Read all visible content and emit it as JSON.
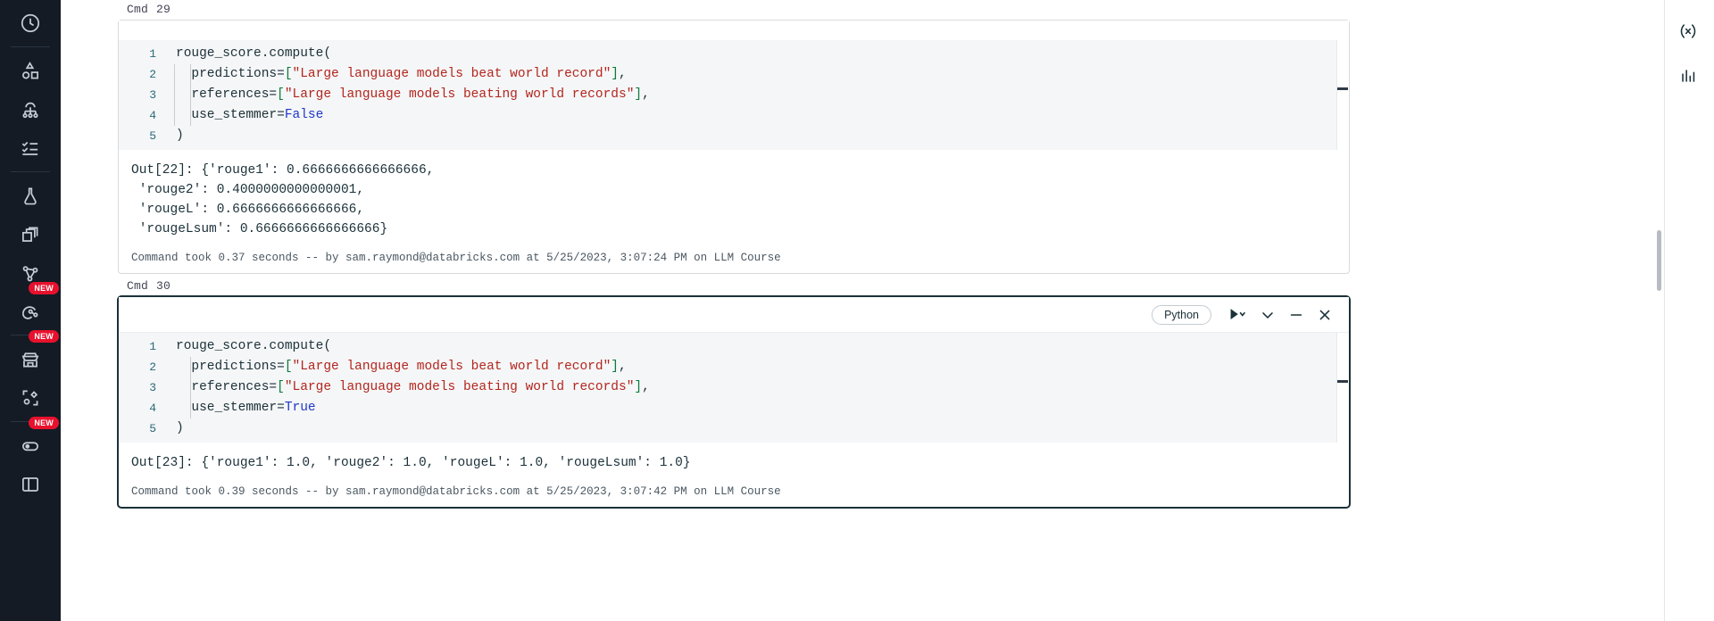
{
  "left_rail": {
    "items": [
      {
        "name": "recents",
        "icon": "clock-icon",
        "badge": null
      },
      {
        "name": "catalog",
        "icon": "shapes-icon",
        "badge": null
      },
      {
        "name": "workflows",
        "icon": "workflow-icon",
        "badge": null
      },
      {
        "name": "tasks",
        "icon": "checklist-icon",
        "badge": null
      },
      {
        "name": "experiments",
        "icon": "flask-icon",
        "badge": null
      },
      {
        "name": "compute",
        "icon": "stacked-squares-icon",
        "badge": null
      },
      {
        "name": "model-serving",
        "icon": "graph-nodes-icon",
        "badge": null
      },
      {
        "name": "feature-store",
        "icon": "feature-store-icon",
        "badge": "NEW"
      },
      {
        "name": "marketplace",
        "icon": "storefront-icon",
        "badge": "NEW"
      },
      {
        "name": "partner-connect",
        "icon": "partner-connect-icon",
        "badge": null
      },
      {
        "name": "preview-toggle",
        "icon": "toggle-icon",
        "badge": "NEW"
      },
      {
        "name": "sidebar-collapse",
        "icon": "panel-icon",
        "badge": null
      }
    ]
  },
  "right_rail": {
    "items": [
      {
        "name": "variables-panel",
        "icon": "variables-icon"
      },
      {
        "name": "data-profile-panel",
        "icon": "bar-chart-icon"
      }
    ]
  },
  "cells": [
    {
      "label": "Cmd",
      "number": "29",
      "selected": false,
      "toolbar_visible": false,
      "language": "Python",
      "code": [
        {
          "n": "1",
          "segments": [
            {
              "t": "rouge_score.compute(",
              "c": "plain"
            }
          ],
          "indent": 0
        },
        {
          "n": "2",
          "segments": [
            {
              "t": "  predictions=",
              "c": "plain"
            },
            {
              "t": "[",
              "c": "brk"
            },
            {
              "t": "\"Large language models beat world record\"",
              "c": "str"
            },
            {
              "t": "]",
              "c": "brk"
            },
            {
              "t": ",",
              "c": "plain"
            }
          ],
          "indent": 1
        },
        {
          "n": "3",
          "segments": [
            {
              "t": "  references=",
              "c": "plain"
            },
            {
              "t": "[",
              "c": "brk"
            },
            {
              "t": "\"Large language models beating world records\"",
              "c": "str"
            },
            {
              "t": "]",
              "c": "brk"
            },
            {
              "t": ",",
              "c": "plain"
            }
          ],
          "indent": 1
        },
        {
          "n": "4",
          "segments": [
            {
              "t": "  use_stemmer=",
              "c": "plain"
            },
            {
              "t": "False",
              "c": "kw"
            }
          ],
          "indent": 1
        },
        {
          "n": "5",
          "segments": [
            {
              "t": ")",
              "c": "paren"
            }
          ],
          "indent": 0
        }
      ],
      "output": "Out[22]: {'rouge1': 0.6666666666666666,\n 'rouge2': 0.4000000000000001,\n 'rougeL': 0.6666666666666666,\n 'rougeLsum': 0.6666666666666666}",
      "status": "Command took 0.37 seconds -- by sam.raymond@databricks.com at 5/25/2023, 3:07:24 PM on LLM Course"
    },
    {
      "label": "Cmd",
      "number": "30",
      "selected": true,
      "toolbar_visible": true,
      "language": "Python",
      "code": [
        {
          "n": "1",
          "segments": [
            {
              "t": "rouge_score.compute(",
              "c": "plain"
            }
          ],
          "indent": 0
        },
        {
          "n": "2",
          "segments": [
            {
              "t": "  predictions=",
              "c": "plain"
            },
            {
              "t": "[",
              "c": "brk"
            },
            {
              "t": "\"Large language models beat world record\"",
              "c": "str"
            },
            {
              "t": "]",
              "c": "brk"
            },
            {
              "t": ",",
              "c": "plain"
            }
          ],
          "indent": 1
        },
        {
          "n": "3",
          "segments": [
            {
              "t": "  references=",
              "c": "plain"
            },
            {
              "t": "[",
              "c": "brk"
            },
            {
              "t": "\"Large language models beating world records\"",
              "c": "str"
            },
            {
              "t": "]",
              "c": "brk"
            },
            {
              "t": ",",
              "c": "plain"
            }
          ],
          "indent": 1
        },
        {
          "n": "4",
          "segments": [
            {
              "t": "  use_stemmer=",
              "c": "plain"
            },
            {
              "t": "True",
              "c": "kw"
            }
          ],
          "indent": 1
        },
        {
          "n": "5",
          "segments": [
            {
              "t": ")",
              "c": "paren"
            }
          ],
          "indent": 0
        }
      ],
      "output": "Out[23]: {'rouge1': 1.0, 'rouge2': 1.0, 'rougeL': 1.0, 'rougeLsum': 1.0}",
      "status": "Command took 0.39 seconds -- by sam.raymond@databricks.com at 5/25/2023, 3:07:42 PM on LLM Course"
    }
  ],
  "toolbar": {
    "run_label": "run-cell",
    "minimize_label": "minimize-cell",
    "collapse_label": "collapse-cell",
    "close_label": "close-cell"
  },
  "colors": {
    "rail_bg": "#141b25",
    "badge_red": "#e8112d",
    "string": "#b3261e",
    "keyword": "#1f38c9",
    "bracket": "#0b7a3d",
    "line_number": "#2b6a7a",
    "editor_bg": "#f5f6f7"
  }
}
